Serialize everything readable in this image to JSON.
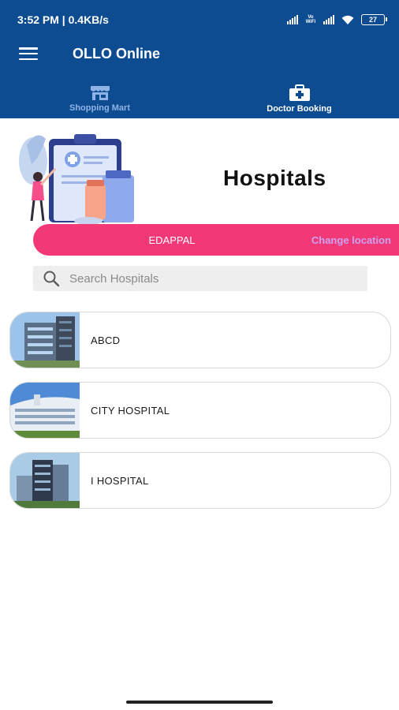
{
  "status_bar": {
    "time_speed": "3:52 PM | 0.4KB/s",
    "volte_label": "Vo WiFi",
    "battery": "27"
  },
  "app_bar": {
    "title": "OLLO Online"
  },
  "tabs": [
    {
      "label": "Shopping Mart",
      "active": false,
      "icon": "store-icon"
    },
    {
      "label": "Doctor Booking",
      "active": true,
      "icon": "medical-kit-icon"
    }
  ],
  "page": {
    "title": "Hospitals"
  },
  "location": {
    "name": "EDAPPAL",
    "change_label": "Change location"
  },
  "search": {
    "placeholder": "Search Hospitals"
  },
  "hospitals": [
    {
      "name": "ABCD"
    },
    {
      "name": "CITY HOSPITAL"
    },
    {
      "name": "I HOSPITAL"
    }
  ],
  "colors": {
    "header": "#0e4c92",
    "accent_pink": "#f33877",
    "change_location": "#c9a2f0"
  }
}
